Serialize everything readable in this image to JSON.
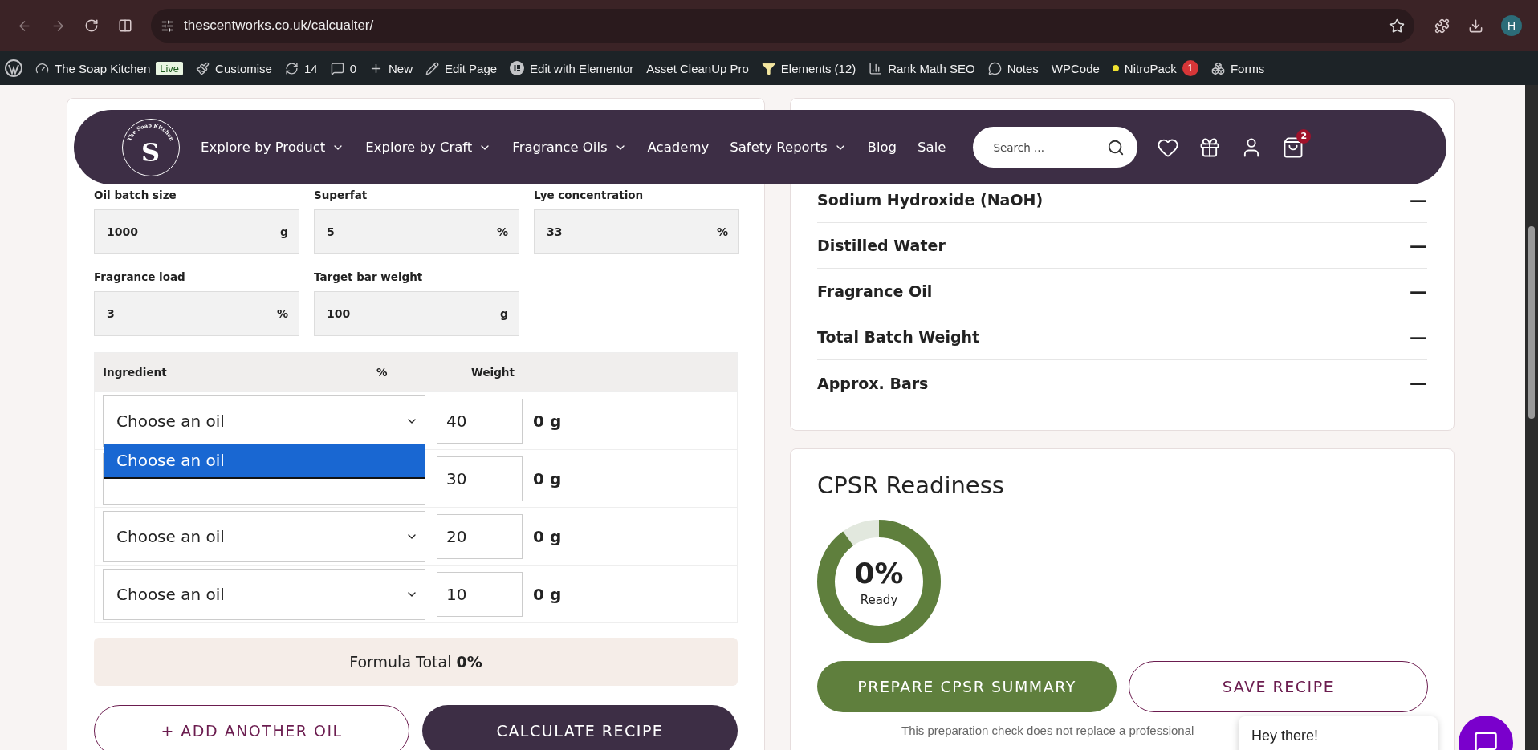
{
  "browser": {
    "url": "thescentworks.co.uk/calcualter/",
    "profile": "H"
  },
  "admin_bar": {
    "items": [
      {
        "kind": "wp"
      },
      {
        "kind": "site",
        "label": "The Soap Kitchen",
        "badge": "Live"
      },
      {
        "kind": "customise",
        "label": "Customise"
      },
      {
        "kind": "updates",
        "label": "14"
      },
      {
        "kind": "comments",
        "label": "0"
      },
      {
        "kind": "new",
        "label": "New"
      },
      {
        "kind": "edit",
        "label": "Edit Page"
      },
      {
        "kind": "elementor",
        "label": "Edit with Elementor"
      },
      {
        "kind": "plain",
        "label": "Asset CleanUp Pro"
      },
      {
        "kind": "elements",
        "label": "Elements (12)"
      },
      {
        "kind": "rankmath",
        "label": "Rank Math SEO"
      },
      {
        "kind": "notes",
        "label": "Notes"
      },
      {
        "kind": "plain",
        "label": "WPCode"
      },
      {
        "kind": "nitro",
        "label": "NitroPack",
        "count": "1"
      },
      {
        "kind": "forms",
        "label": "Forms"
      }
    ]
  },
  "nav": {
    "logo": {
      "letter": "S",
      "arc": "The Soap Kitchen"
    },
    "items": [
      {
        "label": "Explore by Product",
        "has_menu": true
      },
      {
        "label": "Explore by Craft",
        "has_menu": true
      },
      {
        "label": "Fragrance Oils",
        "has_menu": true
      },
      {
        "label": "Academy",
        "has_menu": false
      },
      {
        "label": "Safety Reports",
        "has_menu": true
      },
      {
        "label": "Blog",
        "has_menu": false
      },
      {
        "label": "Sale",
        "has_menu": false
      }
    ],
    "search": {
      "placeholder": "Search ..."
    },
    "cart_count": "2"
  },
  "form": {
    "field_rows": [
      [
        {
          "label": "Oil batch size",
          "value": "1000",
          "unit": "g"
        },
        {
          "label": "Superfat",
          "value": "5",
          "unit": "%"
        },
        {
          "label": "Lye concentration",
          "value": "33",
          "unit": "%"
        }
      ],
      [
        {
          "label": "Fragrance load",
          "value": "3",
          "unit": "%"
        },
        {
          "label": "Target bar weight",
          "value": "100",
          "unit": "g"
        }
      ]
    ]
  },
  "table": {
    "columns": [
      "Ingredient",
      "%",
      "Weight"
    ],
    "rows": [
      {
        "oil": "Choose an oil",
        "percent": "40",
        "weight": "0 g",
        "open": true,
        "options": [
          {
            "label": "Choose an oil",
            "selected": true
          }
        ]
      },
      {
        "percent": "30",
        "weight": "0 g",
        "open": false
      },
      {
        "oil": "Choose an oil",
        "percent": "20",
        "weight": "0 g",
        "open": false
      },
      {
        "oil": "Choose an oil",
        "percent": "10",
        "weight": "0 g",
        "open": false
      }
    ]
  },
  "formula_total": "Formula Total **0%**",
  "form_buttons": [
    {
      "label": "+ ADD ANOTHER OIL",
      "kind": "outline"
    },
    {
      "label": "CALCULATE RECIPE",
      "kind": "filled"
    }
  ],
  "results": [
    {
      "label": "Sodium Hydroxide (NaOH)",
      "value": "—"
    },
    {
      "label": "Distilled Water",
      "value": "—"
    },
    {
      "label": "Fragrance Oil",
      "value": "—"
    },
    {
      "label": "Total Batch Weight",
      "value": "—"
    },
    {
      "label": "Approx. Bars",
      "value": "—"
    }
  ],
  "cpsr": {
    "title": "CPSR Readiness",
    "percent": "0%",
    "caption": "Ready",
    "buttons": [
      {
        "label": "PREPARE CPSR SUMMARY",
        "kind": "filled"
      },
      {
        "label": "SAVE RECIPE",
        "kind": "outline"
      }
    ],
    "note": "This preparation check does not replace a professional"
  },
  "chat": {
    "greeting": "Hey there!"
  }
}
